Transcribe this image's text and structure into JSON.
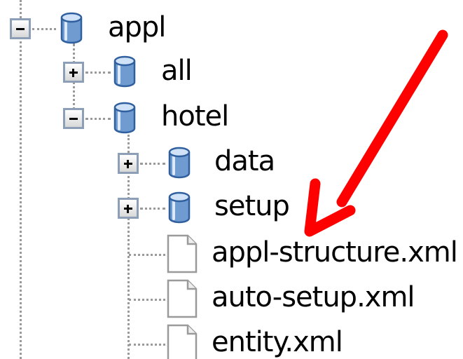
{
  "tree": {
    "nodes": [
      {
        "label": "appl",
        "kind": "folder",
        "state": "expanded",
        "icon": "database-icon"
      },
      {
        "label": "all",
        "kind": "folder",
        "state": "collapsed",
        "icon": "database-icon"
      },
      {
        "label": "hotel",
        "kind": "folder",
        "state": "expanded",
        "icon": "database-icon"
      },
      {
        "label": "data",
        "kind": "folder",
        "state": "collapsed",
        "icon": "database-icon"
      },
      {
        "label": "setup",
        "kind": "folder",
        "state": "collapsed",
        "icon": "database-icon"
      },
      {
        "label": "appl-structure.xml",
        "kind": "file",
        "icon": "file-icon"
      },
      {
        "label": "auto-setup.xml",
        "kind": "file",
        "icon": "file-icon"
      },
      {
        "label": "entity.xml",
        "kind": "file",
        "icon": "file-icon"
      }
    ]
  },
  "annotation": {
    "icon": "red-arrow-icon",
    "color": "#ff0000"
  },
  "colors": {
    "cylinder_top": "#cfe2f7",
    "cylinder_body": "#6f9bd1",
    "cylinder_outline": "#2f5f9e",
    "toggle_border": "#8c9fb6",
    "tree_line": "#9a9a9a"
  }
}
